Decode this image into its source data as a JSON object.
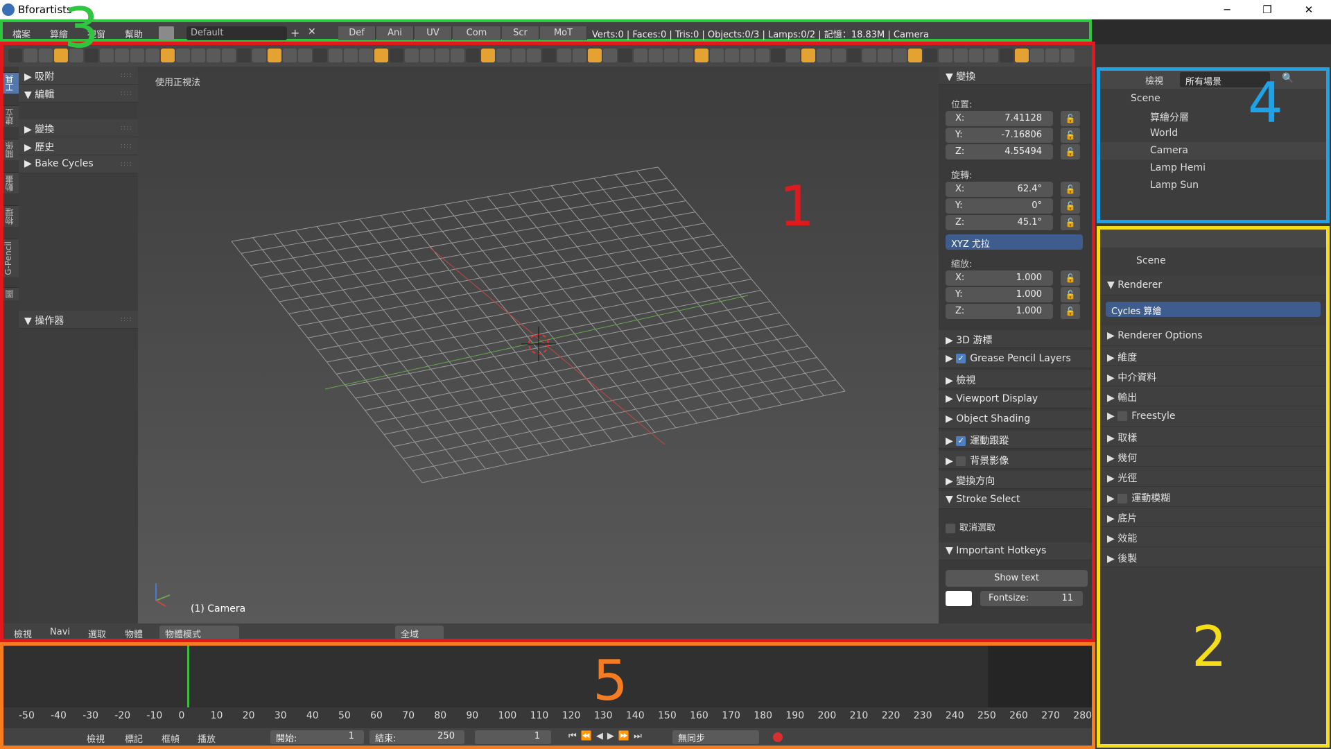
{
  "app": {
    "title": "Bforartists"
  },
  "window_controls": {
    "minimize": "─",
    "maximize": "❐",
    "close": "✕"
  },
  "info_bar": {
    "menus": [
      "檔案",
      "算繪",
      "視窗",
      "幫助"
    ],
    "layout": "Default",
    "add": "+",
    "remove": "✕",
    "screen_tabs": [
      "Def",
      "Ani",
      "UV",
      "Com",
      "Scr",
      "MoT"
    ],
    "stats": "Verts:0 | Faces:0 | Tris:0 | Objects:0/3 | Lamps:0/2 | 記憶：18.83M | Camera"
  },
  "left_tabs": [
    "工具",
    "建立",
    "關係",
    "動畫",
    "物理",
    "G-Pencil",
    "圖"
  ],
  "tool_shelf": {
    "panels": [
      {
        "label": "吸附",
        "arrow": "▶"
      },
      {
        "label": "編輯",
        "arrow": "▼"
      },
      {
        "label": "變換",
        "arrow": "▶"
      },
      {
        "label": "歷史",
        "arrow": "▶"
      },
      {
        "label": "Bake Cycles",
        "arrow": "▶"
      },
      {
        "label": "操作器",
        "arrow": "▼"
      }
    ]
  },
  "viewport": {
    "view_title": "使用正視法",
    "object_label": "(1) Camera"
  },
  "n_panel": {
    "transform_header": "變換",
    "location_label": "位置:",
    "location": [
      {
        "axis": "X:",
        "value": "7.41128"
      },
      {
        "axis": "Y:",
        "value": "-7.16806"
      },
      {
        "axis": "Z:",
        "value": "4.55494"
      }
    ],
    "rotation_label": "旋轉:",
    "rotation": [
      {
        "axis": "X:",
        "value": "62.4°"
      },
      {
        "axis": "Y:",
        "value": "0°"
      },
      {
        "axis": "Z:",
        "value": "45.1°"
      }
    ],
    "rotation_mode": "XYZ 尤拉",
    "scale_label": "縮放:",
    "scale": [
      {
        "axis": "X:",
        "value": "1.000"
      },
      {
        "axis": "Y:",
        "value": "1.000"
      },
      {
        "axis": "Z:",
        "value": "1.000"
      }
    ],
    "panels": [
      {
        "label": "3D 游標",
        "arrow": "▶",
        "check": null
      },
      {
        "label": "Grease Pencil Layers",
        "arrow": "▶",
        "check": true
      },
      {
        "label": "檢視",
        "arrow": "▶",
        "check": null
      },
      {
        "label": "Viewport Display",
        "arrow": "▶",
        "check": null
      },
      {
        "label": "Object Shading",
        "arrow": "▶",
        "check": null
      },
      {
        "label": "運動跟蹤",
        "arrow": "▶",
        "check": true
      },
      {
        "label": "背景影像",
        "arrow": "▶",
        "check": false
      },
      {
        "label": "變換方向",
        "arrow": "▶",
        "check": null
      },
      {
        "label": "Stroke Select",
        "arrow": "▼",
        "check": null
      }
    ],
    "deselect": "取消選取",
    "hotkeys_header": "Important Hotkeys",
    "show_text": "Show text",
    "fontsize_label": "Fontsize:",
    "fontsize_value": "11"
  },
  "viewport_header": {
    "menus": [
      "檢視",
      "Navi",
      "選取",
      "物體"
    ],
    "mode": "物體模式",
    "scope": "全域"
  },
  "timeline": {
    "ruler": [
      "-50",
      "-40",
      "-30",
      "-20",
      "-10",
      "0",
      "10",
      "20",
      "30",
      "40",
      "50",
      "60",
      "70",
      "80",
      "90",
      "100",
      "110",
      "120",
      "130",
      "140",
      "150",
      "160",
      "170",
      "180",
      "190",
      "200",
      "210",
      "220",
      "230",
      "240",
      "250",
      "260",
      "270",
      "280"
    ],
    "menus": [
      "檢視",
      "標記",
      "框幀",
      "播放"
    ],
    "start_label": "開始:",
    "start_value": "1",
    "end_label": "結束:",
    "end_value": "250",
    "current": "1",
    "sync": "無同步"
  },
  "outliner": {
    "view_menu": "檢視",
    "filter": "所有場景",
    "rows": [
      {
        "label": "Scene",
        "indent": 0
      },
      {
        "label": "算繪分層",
        "indent": 1
      },
      {
        "label": "World",
        "indent": 1
      },
      {
        "label": "Camera",
        "indent": 1
      },
      {
        "label": "Lamp Hemi",
        "indent": 1
      },
      {
        "label": "Lamp Sun",
        "indent": 1
      }
    ]
  },
  "properties": {
    "context": "Scene",
    "renderer_header": "Renderer",
    "engine": "Cycles 算繪",
    "panels": [
      {
        "label": "Renderer Options",
        "check": null
      },
      {
        "label": "維度",
        "check": null
      },
      {
        "label": "中介資料",
        "check": null
      },
      {
        "label": "輸出",
        "check": null
      },
      {
        "label": "Freestyle",
        "check": false
      },
      {
        "label": "取樣",
        "check": null
      },
      {
        "label": "幾何",
        "check": null
      },
      {
        "label": "光徑",
        "check": null
      },
      {
        "label": "運動模糊",
        "check": false
      },
      {
        "label": "底片",
        "check": null
      },
      {
        "label": "效能",
        "check": null
      },
      {
        "label": "後製",
        "check": null
      }
    ]
  },
  "annotations": {
    "n1": "1",
    "n2": "2",
    "n3": "3",
    "n4": "4",
    "n5": "5"
  },
  "colors": {
    "red": "#e0191f",
    "green": "#2ec63f",
    "blue": "#1fa3e8",
    "yellow": "#f5de17",
    "orange": "#f57c20"
  }
}
